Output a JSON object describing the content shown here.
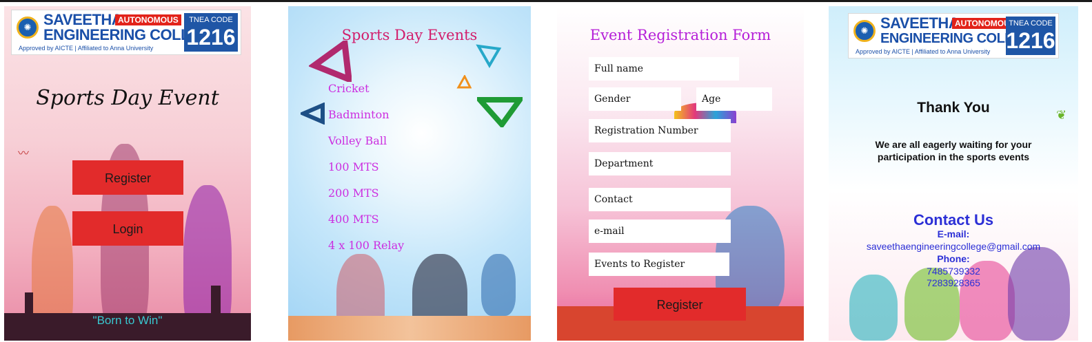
{
  "logo": {
    "line1": "SAVEETHA",
    "badge": "AUTONOMOUS",
    "line2": "ENGINEERING COLLEGE",
    "approved": "Approved by AICTE  |  Affiliated to Anna University",
    "code_label": "TNEA CODE",
    "code": "1216"
  },
  "screen1": {
    "title": "Sports Day Event",
    "register_label": "Register",
    "login_label": "Login",
    "tagline": "\"Born to Win\""
  },
  "screen2": {
    "title": "Sports Day Events",
    "events": [
      "Cricket",
      "Badminton",
      "Volley Ball",
      "100 MTS",
      "200 MTS",
      "400 MTS",
      "4 x 100 Relay"
    ]
  },
  "screen3": {
    "title": "Event Registration Form",
    "fields": {
      "full_name": "Full name",
      "gender": "Gender",
      "age": "Age",
      "registration_number": "Registration Number",
      "department": "Department",
      "contact": "Contact",
      "email": "e-mail",
      "events": "Events to Register"
    },
    "register_label": "Register"
  },
  "screen4": {
    "thank_you": "Thank You",
    "message": "We are all eagerly waiting for your participation in the sports events",
    "contact_heading": "Contact Us",
    "email_label": "E-mail:",
    "email": "saveethaengineeringcollege@gmail.com",
    "phone_label": "Phone:",
    "phones": [
      "7485739332",
      "7283928365"
    ]
  },
  "colors": {
    "button_red": "#e22b2b",
    "brand_blue": "#1a4fa8",
    "event_magenta": "#cc2ee0",
    "contact_blue": "#2b2fd6",
    "tagline_teal": "#39c7cf"
  }
}
